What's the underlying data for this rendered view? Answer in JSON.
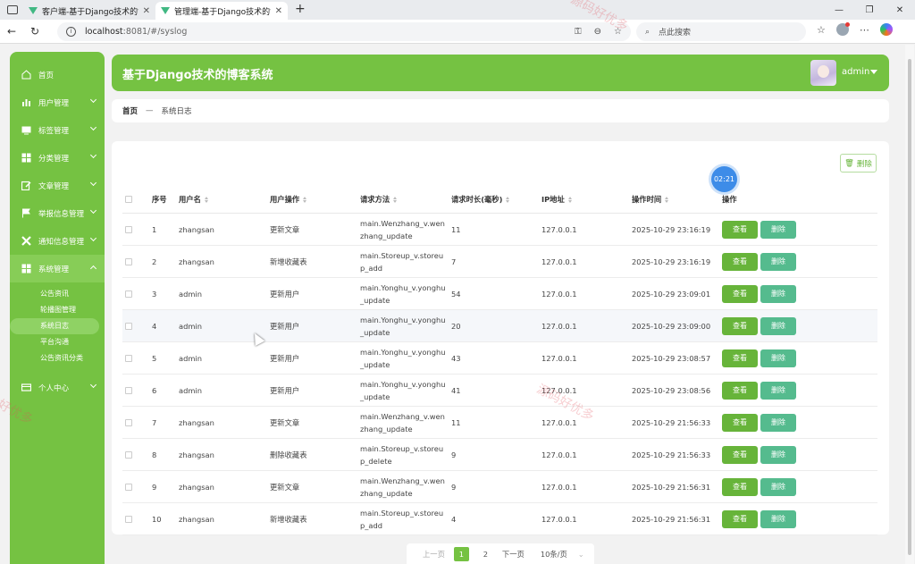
{
  "browser": {
    "tabs": [
      {
        "label": "客户端-基于Django技术的博客系统",
        "active": false
      },
      {
        "label": "管理端-基于Django技术的博客系统",
        "active": true
      }
    ],
    "url_host": "localhost",
    "url_path": ":8081/#/syslog",
    "search_placeholder": "点此搜索"
  },
  "header": {
    "title": "基于Django技术的博客系统",
    "username": "admin"
  },
  "sidebar": {
    "items": [
      {
        "label": "首页",
        "icon": "home-icon"
      },
      {
        "label": "用户管理",
        "icon": "bar-chart-icon"
      },
      {
        "label": "标签管理",
        "icon": "monitor-icon"
      },
      {
        "label": "分类管理",
        "icon": "grid-icon"
      },
      {
        "label": "文章管理",
        "icon": "edit-icon"
      },
      {
        "label": "举报信息管理",
        "icon": "flag-icon"
      },
      {
        "label": "通知信息管理",
        "icon": "cross-icon"
      },
      {
        "label": "系统管理",
        "icon": "grid-icon"
      },
      {
        "label": "个人中心",
        "icon": "card-icon"
      }
    ],
    "sub_items": [
      "公告资讯",
      "轮播图管理",
      "系统日志",
      "平台沟通",
      "公告资讯分类"
    ]
  },
  "breadcrumb": {
    "home": "首页",
    "separator": "—",
    "current": "系统日志"
  },
  "toolbar": {
    "delete_label": "删除",
    "timer": "02:21"
  },
  "table": {
    "columns": [
      "序号",
      "用户名",
      "用户操作",
      "请求方法",
      "请求时长(毫秒)",
      "IP地址",
      "操作时间",
      "操作"
    ],
    "rows": [
      {
        "no": "1",
        "user": "zhangsan",
        "op": "更新文章",
        "method": "main.Wenzhang_v.wenzhang_update",
        "duration": "11",
        "ip": "127.0.0.1",
        "time": "2025-10-29 23:16:19"
      },
      {
        "no": "2",
        "user": "zhangsan",
        "op": "新增收藏表",
        "method": "main.Storeup_v.storeup_add",
        "duration": "7",
        "ip": "127.0.0.1",
        "time": "2025-10-29 23:16:19"
      },
      {
        "no": "3",
        "user": "admin",
        "op": "更新用户",
        "method": "main.Yonghu_v.yonghu_update",
        "duration": "54",
        "ip": "127.0.0.1",
        "time": "2025-10-29 23:09:01"
      },
      {
        "no": "4",
        "user": "admin",
        "op": "更新用户",
        "method": "main.Yonghu_v.yonghu_update",
        "duration": "20",
        "ip": "127.0.0.1",
        "time": "2025-10-29 23:09:00"
      },
      {
        "no": "5",
        "user": "admin",
        "op": "更新用户",
        "method": "main.Yonghu_v.yonghu_update",
        "duration": "43",
        "ip": "127.0.0.1",
        "time": "2025-10-29 23:08:57"
      },
      {
        "no": "6",
        "user": "admin",
        "op": "更新用户",
        "method": "main.Yonghu_v.yonghu_update",
        "duration": "41",
        "ip": "127.0.0.1",
        "time": "2025-10-29 23:08:56"
      },
      {
        "no": "7",
        "user": "zhangsan",
        "op": "更新文章",
        "method": "main.Wenzhang_v.wenzhang_update",
        "duration": "11",
        "ip": "127.0.0.1",
        "time": "2025-10-29 21:56:33"
      },
      {
        "no": "8",
        "user": "zhangsan",
        "op": "删除收藏表",
        "method": "main.Storeup_v.storeup_delete",
        "duration": "9",
        "ip": "127.0.0.1",
        "time": "2025-10-29 21:56:33"
      },
      {
        "no": "9",
        "user": "zhangsan",
        "op": "更新文章",
        "method": "main.Wenzhang_v.wenzhang_update",
        "duration": "9",
        "ip": "127.0.0.1",
        "time": "2025-10-29 21:56:31"
      },
      {
        "no": "10",
        "user": "zhangsan",
        "op": "新增收藏表",
        "method": "main.Storeup_v.storeup_add",
        "duration": "4",
        "ip": "127.0.0.1",
        "time": "2025-10-29 21:56:31"
      }
    ],
    "view_label": "查看",
    "delete_label": "删除"
  },
  "pager": {
    "prev": "上一页",
    "pages": [
      "1",
      "2"
    ],
    "next": "下一页",
    "size": "10条/页"
  },
  "watermark": "源码好优多",
  "colors": {
    "primary": "#75c242",
    "view_button": "#67b43a",
    "delete_button": "#55bb8e"
  }
}
